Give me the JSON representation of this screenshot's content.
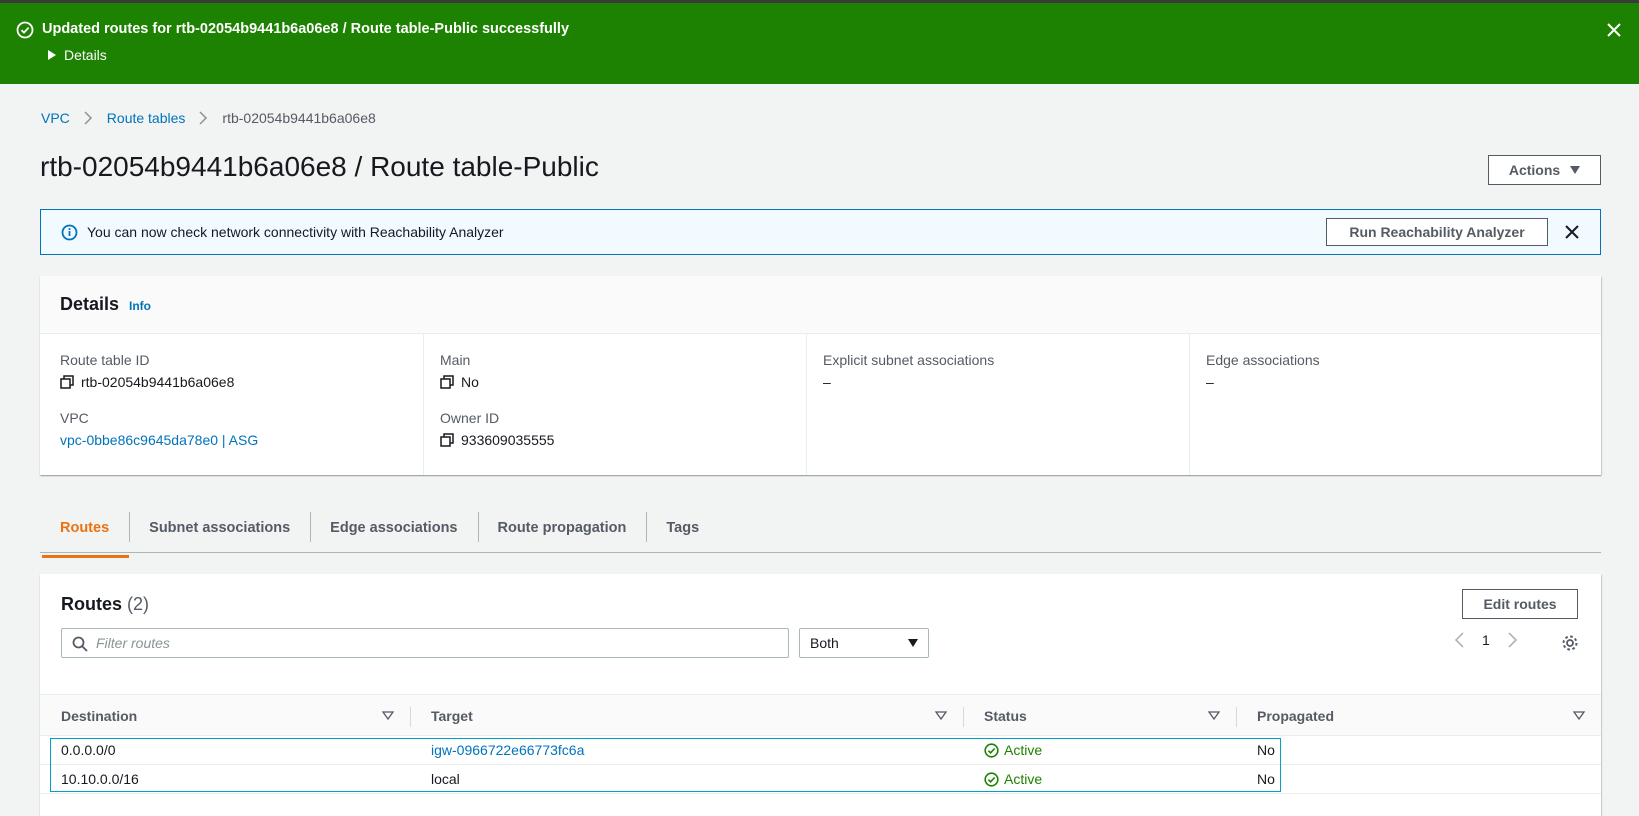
{
  "flash": {
    "message": "Updated routes for rtb-02054b9441b6a06e8 / Route table-Public successfully",
    "details_label": "Details"
  },
  "breadcrumb": {
    "items": [
      "VPC",
      "Route tables"
    ],
    "current": "rtb-02054b9441b6a06e8"
  },
  "page_title": "rtb-02054b9441b6a06e8 / Route table-Public",
  "actions_label": "Actions",
  "info_alert": {
    "text": "You can now check network connectivity with Reachability Analyzer",
    "button": "Run Reachability Analyzer"
  },
  "details": {
    "title": "Details",
    "info_link": "Info",
    "route_table_id_label": "Route table ID",
    "route_table_id": "rtb-02054b9441b6a06e8",
    "vpc_label": "VPC",
    "vpc": "vpc-0bbe86c9645da78e0 | ASG",
    "main_label": "Main",
    "main": "No",
    "owner_label": "Owner ID",
    "owner": "933609035555",
    "explicit_label": "Explicit subnet associations",
    "explicit": "–",
    "edge_label": "Edge associations",
    "edge": "–"
  },
  "tabs": [
    "Routes",
    "Subnet associations",
    "Edge associations",
    "Route propagation",
    "Tags"
  ],
  "routes": {
    "title": "Routes",
    "count": "(2)",
    "edit_button": "Edit routes",
    "filter_placeholder": "Filter routes",
    "select_value": "Both",
    "page": "1",
    "columns": [
      "Destination",
      "Target",
      "Status",
      "Propagated"
    ],
    "rows": [
      {
        "destination": "0.0.0.0/0",
        "target": "igw-0966722e66773fc6a",
        "status": "Active",
        "propagated": "No"
      },
      {
        "destination": "10.10.0.0/16",
        "target": "local",
        "status": "Active",
        "propagated": "No"
      }
    ]
  },
  "colors": {
    "success": "#1d8102",
    "link": "#0073bb",
    "accent": "#ec7211"
  }
}
